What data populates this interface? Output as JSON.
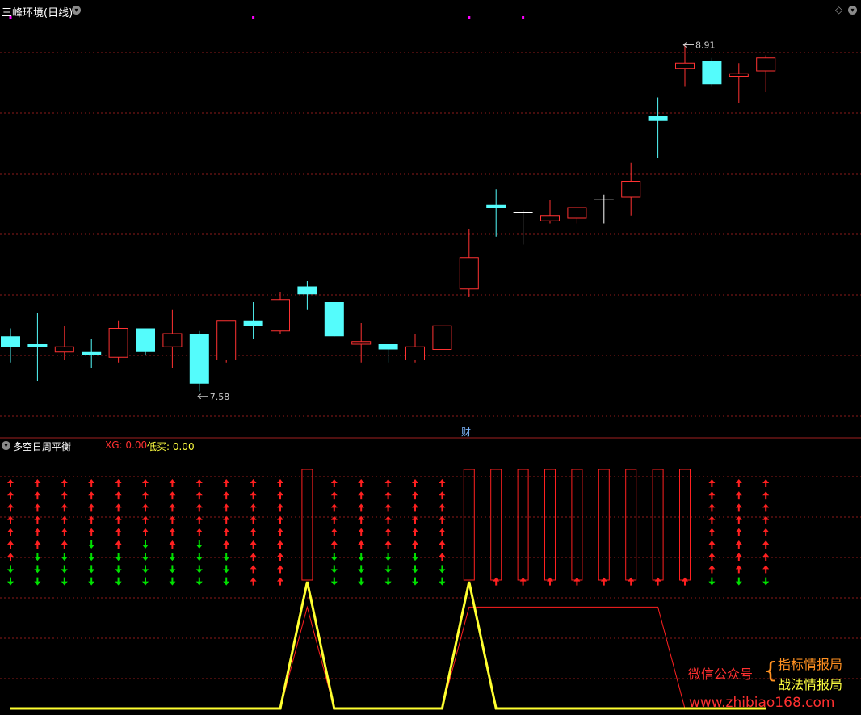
{
  "main_panel": {
    "title": "三峰环境(日线)",
    "cai_label": "财",
    "diamond_icon": "diamond-icon",
    "toggle_icon": "chevron-down-icon"
  },
  "sub_panel": {
    "title": "多空日周平衡",
    "xg_label": "XG: 0.00",
    "buy_label": "低买: 0.00",
    "toggle_icon": "chevron-down-icon"
  },
  "watermark": {
    "wechat": "微信公众号",
    "line1": "指标情报局",
    "line2": "战法情报局",
    "url": "www.zhibiao168.com"
  },
  "colors": {
    "up": "#ff3232",
    "down": "#54fcfc",
    "doji": "#ffffff",
    "grid": "#8b1a1a",
    "arrow_up": "#ff2020",
    "arrow_down": "#00e000",
    "line_main": "#ffff30",
    "line_thin": "#ff2020",
    "marker": "#ff00ff"
  },
  "chart_data": [
    {
      "type": "candlestick",
      "title": "三峰环境(日线)",
      "ylim": [
        7.45,
        9.05
      ],
      "annotations": [
        {
          "label": "8.91",
          "value": 8.91,
          "type": "high",
          "index": 25
        },
        {
          "label": "7.58",
          "value": 7.58,
          "type": "low",
          "index": 7
        }
      ],
      "top_markers": [
        0,
        9,
        17,
        19
      ],
      "ohlc": [
        [
          7.8,
          7.83,
          7.7,
          7.76
        ],
        [
          7.77,
          7.89,
          7.63,
          7.76
        ],
        [
          7.74,
          7.84,
          7.71,
          7.76
        ],
        [
          7.74,
          7.79,
          7.68,
          7.73
        ],
        [
          7.72,
          7.86,
          7.7,
          7.83
        ],
        [
          7.83,
          7.83,
          7.73,
          7.74
        ],
        [
          7.76,
          7.9,
          7.68,
          7.81
        ],
        [
          7.81,
          7.82,
          7.59,
          7.62
        ],
        [
          7.71,
          7.86,
          7.7,
          7.86
        ],
        [
          7.86,
          7.93,
          7.79,
          7.84
        ],
        [
          7.82,
          7.97,
          7.81,
          7.94
        ],
        [
          7.99,
          8.01,
          7.9,
          7.96
        ],
        [
          7.93,
          7.93,
          7.8,
          7.8
        ],
        [
          7.77,
          7.85,
          7.7,
          7.78
        ],
        [
          7.77,
          7.77,
          7.7,
          7.75
        ],
        [
          7.71,
          7.81,
          7.7,
          7.76
        ],
        [
          7.75,
          7.83,
          7.75,
          7.84
        ],
        [
          7.98,
          8.21,
          7.95,
          8.1
        ],
        [
          8.3,
          8.36,
          8.18,
          8.29
        ],
        [
          8.27,
          8.28,
          8.15,
          8.27
        ],
        [
          8.24,
          8.32,
          8.23,
          8.26
        ],
        [
          8.25,
          8.29,
          8.23,
          8.29
        ],
        [
          8.32,
          8.34,
          8.23,
          8.32
        ],
        [
          8.33,
          8.46,
          8.26,
          8.39
        ],
        [
          8.64,
          8.71,
          8.48,
          8.62
        ],
        [
          8.82,
          8.91,
          8.75,
          8.84
        ],
        [
          8.85,
          8.86,
          8.75,
          8.76
        ],
        [
          8.79,
          8.84,
          8.69,
          8.8
        ],
        [
          8.81,
          8.87,
          8.73,
          8.86
        ]
      ]
    },
    {
      "type": "indicator",
      "title": "多空日周平衡",
      "ylim": [
        0,
        10
      ],
      "rows": 9,
      "bar_days": [
        11,
        17,
        18,
        19,
        20,
        21,
        22,
        23,
        24,
        25
      ],
      "columns": [
        {
          "up": 7,
          "down": 2
        },
        {
          "up": 6,
          "down": 3
        },
        {
          "up": 6,
          "down": 3
        },
        {
          "up": 5,
          "down": 4
        },
        {
          "up": 6,
          "down": 3
        },
        {
          "up": 5,
          "down": 4
        },
        {
          "up": 6,
          "down": 3
        },
        {
          "up": 5,
          "down": 4
        },
        {
          "up": 6,
          "down": 3
        },
        {
          "up": 9,
          "down": 0
        },
        {
          "up": 9,
          "down": 0
        },
        {
          "bar": true
        },
        {
          "up": 6,
          "down": 3
        },
        {
          "up": 6,
          "down": 3
        },
        {
          "up": 6,
          "down": 3
        },
        {
          "up": 6,
          "down": 3
        },
        {
          "up": 7,
          "down": 2
        },
        {
          "bar": true
        },
        {
          "bar": true,
          "up": 1,
          "down": 0
        },
        {
          "bar": true,
          "up": 1,
          "down": 0
        },
        {
          "bar": true,
          "up": 1,
          "down": 0
        },
        {
          "bar": true,
          "up": 1,
          "down": 0
        },
        {
          "bar": true,
          "up": 1,
          "down": 0
        },
        {
          "bar": true,
          "up": 1,
          "down": 0
        },
        {
          "bar": true,
          "up": 1,
          "down": 0
        },
        {
          "bar": true,
          "up": 1,
          "down": 0
        },
        {
          "up": 8,
          "down": 1
        },
        {
          "up": 8,
          "down": 1
        },
        {
          "up": 8,
          "down": 1
        }
      ],
      "series": [
        {
          "name": "XG",
          "values": [
            0,
            0,
            0,
            0,
            0,
            0,
            0,
            0,
            0,
            0,
            0,
            1,
            0,
            0,
            0,
            0,
            0,
            1,
            0,
            0,
            0,
            0,
            0,
            0,
            0,
            0,
            0,
            0,
            0
          ]
        },
        {
          "name": "低买",
          "values": [
            0,
            0,
            0,
            0,
            0,
            0,
            0,
            0,
            0,
            0,
            0,
            0.8,
            0,
            0,
            0,
            0,
            0,
            0.8,
            0.8,
            0.8,
            0.8,
            0.8,
            0.8,
            0.8,
            0.8,
            0,
            0,
            0,
            0
          ]
        }
      ]
    }
  ]
}
